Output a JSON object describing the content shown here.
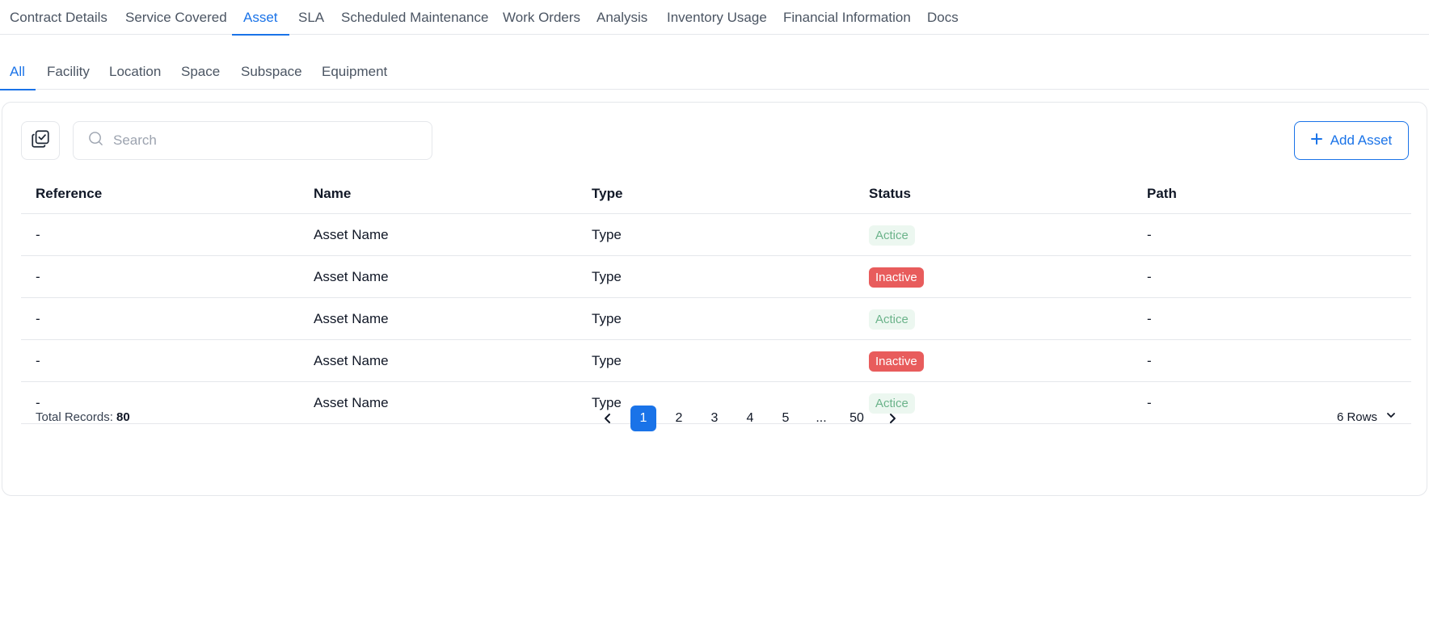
{
  "main_tabs": [
    "Contract Details",
    "Service Covered",
    "Asset",
    "SLA",
    "Scheduled Maintenance",
    "Work Orders",
    "Analysis",
    "Inventory Usage",
    "Financial Information",
    "Docs"
  ],
  "main_tabs_active": "Asset",
  "sub_tabs": [
    "All",
    "Facility",
    "Location",
    "Space",
    "Subspace",
    "Equipment"
  ],
  "sub_tabs_active": "All",
  "toolbar": {
    "search_placeholder": "Search",
    "add_button_label": "Add Asset",
    "select_icon": "multi-select-icon",
    "search_icon": "search-icon",
    "add_icon": "plus-icon"
  },
  "table": {
    "headers": [
      "Reference",
      "Name",
      "Type",
      "Status",
      "Path"
    ],
    "rows": [
      {
        "reference": "-",
        "name": "Asset Name",
        "type": "Type",
        "status": "Actice",
        "path": "-"
      },
      {
        "reference": "-",
        "name": "Asset Name",
        "type": "Type",
        "status": "Inactive",
        "path": "-"
      },
      {
        "reference": "-",
        "name": "Asset Name",
        "type": "Type",
        "status": "Actice",
        "path": "-"
      },
      {
        "reference": "-",
        "name": "Asset Name",
        "type": "Type",
        "status": "Inactive",
        "path": "-"
      },
      {
        "reference": "-",
        "name": "Asset Name",
        "type": "Type",
        "status": "Actice",
        "path": "-"
      }
    ]
  },
  "footer": {
    "total_label": "Total Records:",
    "total_value": "80",
    "pages": [
      "1",
      "2",
      "3",
      "4",
      "5",
      "...",
      "50"
    ],
    "current_page": "1",
    "rows_per_page": "6 Rows"
  },
  "colors": {
    "accent": "#1a73e8",
    "active_badge_bg": "#ecf7f0",
    "active_badge_text": "#6bb38a",
    "inactive_badge_bg": "#e85c5c"
  }
}
